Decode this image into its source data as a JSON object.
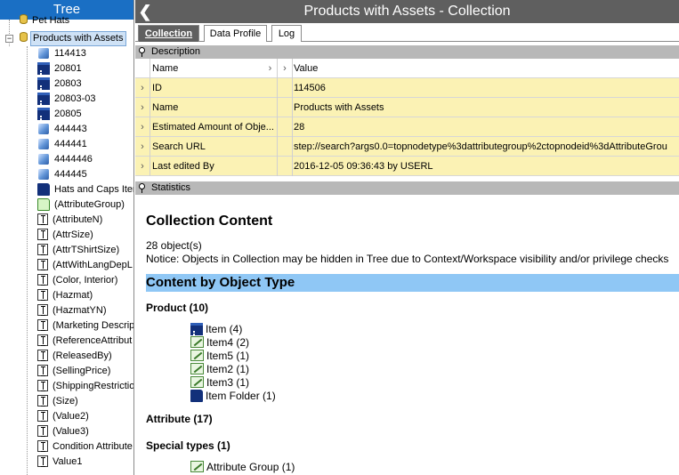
{
  "tree": {
    "header": "Tree",
    "items": [
      {
        "label": "Pet Hats",
        "icon": "database-icon",
        "depth": 1
      },
      {
        "label": "Products with Assets",
        "icon": "database-icon",
        "depth": 1,
        "selected": true,
        "expander": "-"
      },
      {
        "label": "114413",
        "icon": "cube-icon",
        "depth": 2
      },
      {
        "label": "20801",
        "icon": "item-icon",
        "depth": 2
      },
      {
        "label": "20803",
        "icon": "item-icon",
        "depth": 2
      },
      {
        "label": "20803-03",
        "icon": "item-icon",
        "depth": 2
      },
      {
        "label": "20805",
        "icon": "item-icon",
        "depth": 2
      },
      {
        "label": "444443",
        "icon": "cube-icon",
        "depth": 2
      },
      {
        "label": "444441",
        "icon": "cube-icon",
        "depth": 2
      },
      {
        "label": "4444446",
        "icon": "cube-icon",
        "depth": 2
      },
      {
        "label": "444445",
        "icon": "cube-icon",
        "depth": 2
      },
      {
        "label": "Hats and Caps Iter",
        "icon": "folder-icon",
        "depth": 2
      },
      {
        "label": "(AttributeGroup)",
        "icon": "folder-open-icon",
        "depth": 2
      },
      {
        "label": "(AttributeN)",
        "icon": "attribute-icon",
        "depth": 2
      },
      {
        "label": "(AttrSize)",
        "icon": "attribute-icon",
        "depth": 2
      },
      {
        "label": "(AttrTShirtSize)",
        "icon": "attribute-icon",
        "depth": 2
      },
      {
        "label": "(AttWithLangDepL",
        "icon": "attribute-icon",
        "depth": 2
      },
      {
        "label": "(Color, Interior)",
        "icon": "attribute-icon",
        "depth": 2
      },
      {
        "label": "(Hazmat)",
        "icon": "attribute-icon",
        "depth": 2
      },
      {
        "label": "(HazmatYN)",
        "icon": "attribute-icon",
        "depth": 2
      },
      {
        "label": "(Marketing Descrip",
        "icon": "attribute-icon",
        "depth": 2
      },
      {
        "label": "(ReferenceAttribut",
        "icon": "attribute-icon",
        "depth": 2
      },
      {
        "label": "(ReleasedBy)",
        "icon": "attribute-icon",
        "depth": 2
      },
      {
        "label": "(SellingPrice)",
        "icon": "attribute-icon",
        "depth": 2
      },
      {
        "label": "(ShippingRestrictio",
        "icon": "attribute-icon",
        "depth": 2
      },
      {
        "label": "(Size)",
        "icon": "attribute-icon",
        "depth": 2
      },
      {
        "label": "(Value2)",
        "icon": "attribute-icon",
        "depth": 2
      },
      {
        "label": "(Value3)",
        "icon": "attribute-icon",
        "depth": 2
      },
      {
        "label": "Condition Attribute",
        "icon": "attribute-icon",
        "depth": 2
      },
      {
        "label": "Value1",
        "icon": "attribute-icon",
        "depth": 2
      }
    ]
  },
  "main": {
    "title": "Products with Assets - Collection",
    "back_glyph": "❮",
    "tabs": [
      {
        "label": "Collection",
        "active": true
      },
      {
        "label": "Data Profile",
        "active": false
      },
      {
        "label": "Log",
        "active": false
      }
    ],
    "description": {
      "section_label": "Description",
      "columns": {
        "name": "Name",
        "value": "Value"
      },
      "rows": [
        {
          "name": "ID",
          "value": "114506"
        },
        {
          "name": "Name",
          "value": "Products with Assets"
        },
        {
          "name": "Estimated Amount of Obje...",
          "value": "28"
        },
        {
          "name": "Search URL",
          "value": "step://search?args0.0=topnodetype%3dattributegroup%2ctopnodeid%3dAttributeGrou"
        },
        {
          "name": "Last edited By",
          "value": "2016-12-05 09:36:43 by USERL"
        }
      ]
    },
    "statistics": {
      "section_label": "Statistics",
      "title": "Collection Content",
      "object_count": "28 object(s)",
      "notice": "Notice: Objects in Collection may be hidden in Tree due to Context/Workspace visibility and/or privilege checks",
      "content_by_type_title": "Content by Object Type",
      "product_group": "Product (10)",
      "product_items": [
        {
          "label": "Item (4)",
          "icon": "item-icon"
        },
        {
          "label": "Item4 (2)",
          "icon": "edit-icon"
        },
        {
          "label": "Item5 (1)",
          "icon": "edit-icon"
        },
        {
          "label": "Item2 (1)",
          "icon": "edit-icon"
        },
        {
          "label": "Item3 (1)",
          "icon": "edit-icon"
        },
        {
          "label": "Item Folder (1)",
          "icon": "folder-icon"
        }
      ],
      "attribute_group": "Attribute (17)",
      "special_group": "Special types (1)",
      "special_items": [
        {
          "label": "Attribute Group (1)",
          "icon": "edit-icon"
        }
      ]
    }
  },
  "glyphs": {
    "row_expander": "›",
    "tree_minus": "−"
  }
}
